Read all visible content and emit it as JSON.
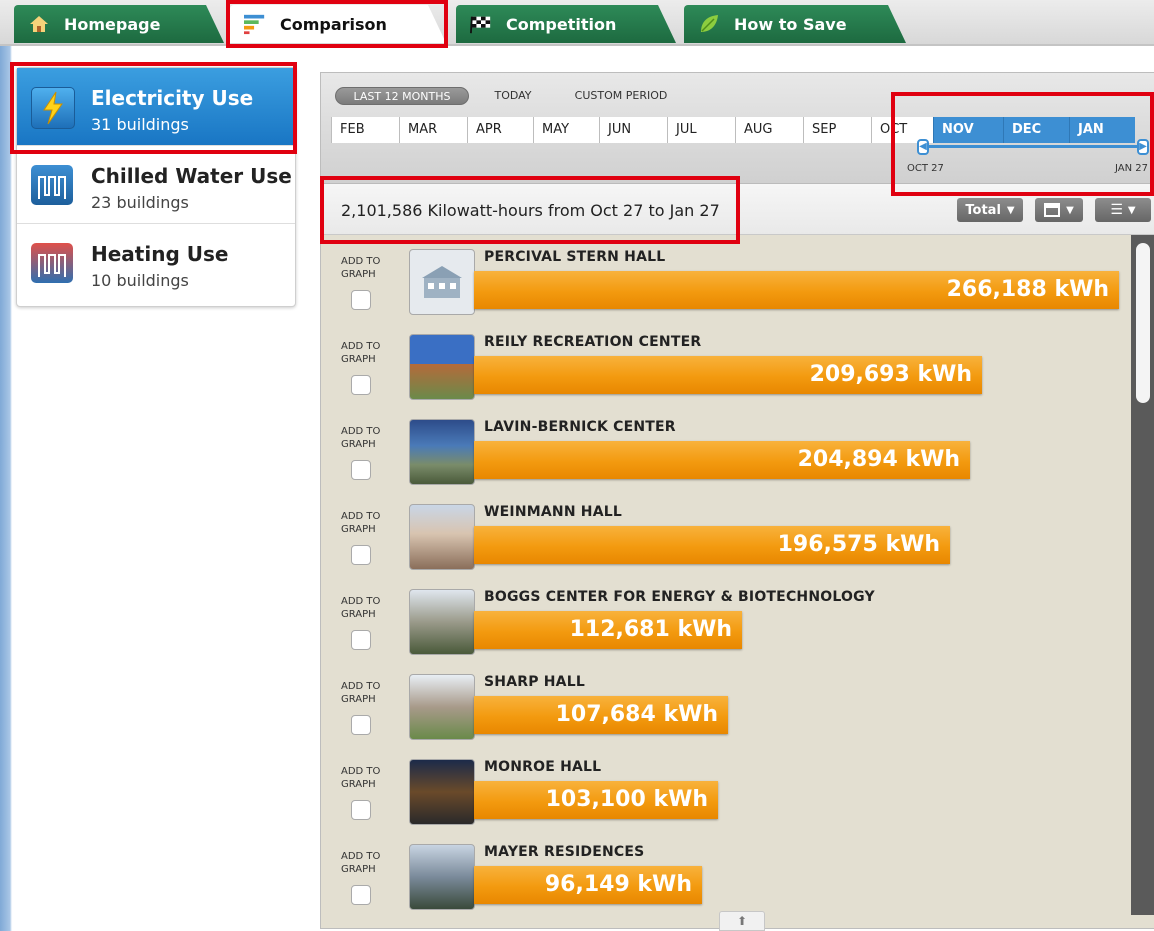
{
  "tabs": [
    {
      "label": "Homepage",
      "icon": "house-icon"
    },
    {
      "label": "Comparison",
      "icon": "bar-chart-icon"
    },
    {
      "label": "Competition",
      "icon": "checkered-flag-icon"
    },
    {
      "label": "How to Save",
      "icon": "leaf-icon"
    }
  ],
  "utilities": [
    {
      "name": "Electricity Use",
      "count": "31 buildings",
      "icon": "lightning-icon"
    },
    {
      "name": "Chilled Water Use",
      "count": "23 buildings",
      "icon": "chilled-water-icon"
    },
    {
      "name": "Heating Use",
      "count": "10 buildings",
      "icon": "heating-icon"
    }
  ],
  "period": {
    "options": [
      "LAST 12 MONTHS",
      "TODAY",
      "CUSTOM PERIOD"
    ],
    "months": [
      "FEB",
      "MAR",
      "APR",
      "MAY",
      "JUN",
      "JUL",
      "AUG",
      "SEP",
      "OCT",
      "NOV",
      "DEC",
      "JAN"
    ],
    "range_start": "OCT 27",
    "range_end": "JAN 27"
  },
  "summary": "2,101,586 Kilowatt-hours from Oct 27 to Jan 27",
  "controls": {
    "total_label": "Total"
  },
  "add_to_graph": "ADD TO GRAPH",
  "buildings": [
    {
      "name": "PERCIVAL STERN HALL",
      "value": "266,188 kWh",
      "kwh": 266188
    },
    {
      "name": "REILY RECREATION CENTER",
      "value": "209,693 kWh",
      "kwh": 209693
    },
    {
      "name": "LAVIN-BERNICK CENTER",
      "value": "204,894 kWh",
      "kwh": 204894
    },
    {
      "name": "WEINMANN HALL",
      "value": "196,575 kWh",
      "kwh": 196575
    },
    {
      "name": "BOGGS CENTER FOR ENERGY & BIOTECHNOLOGY",
      "value": "112,681 kWh",
      "kwh": 112681
    },
    {
      "name": "SHARP HALL",
      "value": "107,684 kWh",
      "kwh": 107684
    },
    {
      "name": "MONROE HALL",
      "value": "103,100 kWh",
      "kwh": 103100
    },
    {
      "name": "MAYER RESIDENCES",
      "value": "96,149 kWh",
      "kwh": 96149
    }
  ],
  "colors": {
    "accent": "#3d8fd3",
    "bar": "#f39a0f",
    "tab": "#1d6a40",
    "highlight": "#e00010"
  }
}
